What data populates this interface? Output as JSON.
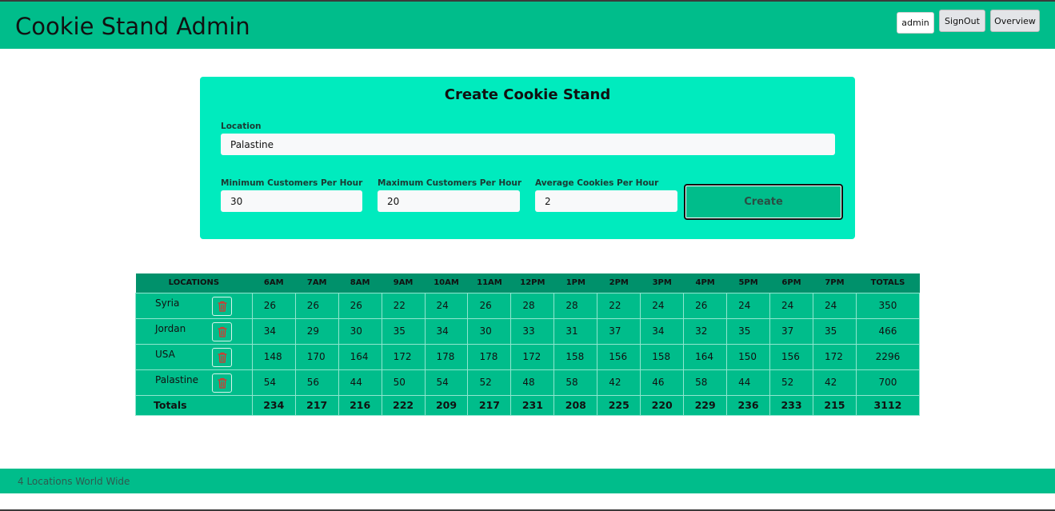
{
  "header": {
    "title": "Cookie Stand Admin",
    "user": "admin",
    "signout_label": "SignOut",
    "overview_label": "Overview"
  },
  "form": {
    "title": "Create Cookie Stand",
    "location_label": "Location",
    "location_value": "Palastine",
    "min_label": "Minimum Customers Per Hour",
    "min_value": "30",
    "max_label": "Maximum Customers Per Hour",
    "max_value": "20",
    "avg_label": "Average Cookies Per Hour",
    "avg_value": "2",
    "create_label": "Create"
  },
  "table": {
    "headers": [
      "LOCATIONS",
      "6AM",
      "7AM",
      "8AM",
      "9AM",
      "10AM",
      "11AM",
      "12PM",
      "1PM",
      "2PM",
      "3PM",
      "4PM",
      "5PM",
      "6PM",
      "7PM",
      "TOTALS"
    ],
    "rows": [
      {
        "location": "Syria",
        "hours": [
          "26",
          "26",
          "26",
          "22",
          "24",
          "26",
          "28",
          "28",
          "22",
          "24",
          "26",
          "24",
          "24",
          "24"
        ],
        "total": "350"
      },
      {
        "location": "Jordan",
        "hours": [
          "34",
          "29",
          "30",
          "35",
          "34",
          "30",
          "33",
          "31",
          "37",
          "34",
          "32",
          "35",
          "37",
          "35"
        ],
        "total": "466"
      },
      {
        "location": "USA",
        "hours": [
          "148",
          "170",
          "164",
          "172",
          "178",
          "178",
          "172",
          "158",
          "156",
          "158",
          "164",
          "150",
          "156",
          "172"
        ],
        "total": "2296"
      },
      {
        "location": "Palastine",
        "hours": [
          "54",
          "56",
          "44",
          "50",
          "54",
          "52",
          "48",
          "58",
          "42",
          "46",
          "58",
          "44",
          "52",
          "42"
        ],
        "total": "700"
      }
    ],
    "totals_label": "Totals",
    "totals": [
      "234",
      "217",
      "216",
      "222",
      "209",
      "217",
      "231",
      "208",
      "225",
      "220",
      "229",
      "236",
      "233",
      "215"
    ],
    "grand_total": "3112"
  },
  "footer": {
    "text": "4 Locations World Wide"
  },
  "colors": {
    "header_bg": "#00bd8b",
    "card_bg": "#00ebbe",
    "table_head_bg": "#00916b",
    "table_row_bg": "#00bd8b",
    "trash_icon": "#e0302a"
  },
  "icons": {
    "delete": "trash-icon"
  }
}
